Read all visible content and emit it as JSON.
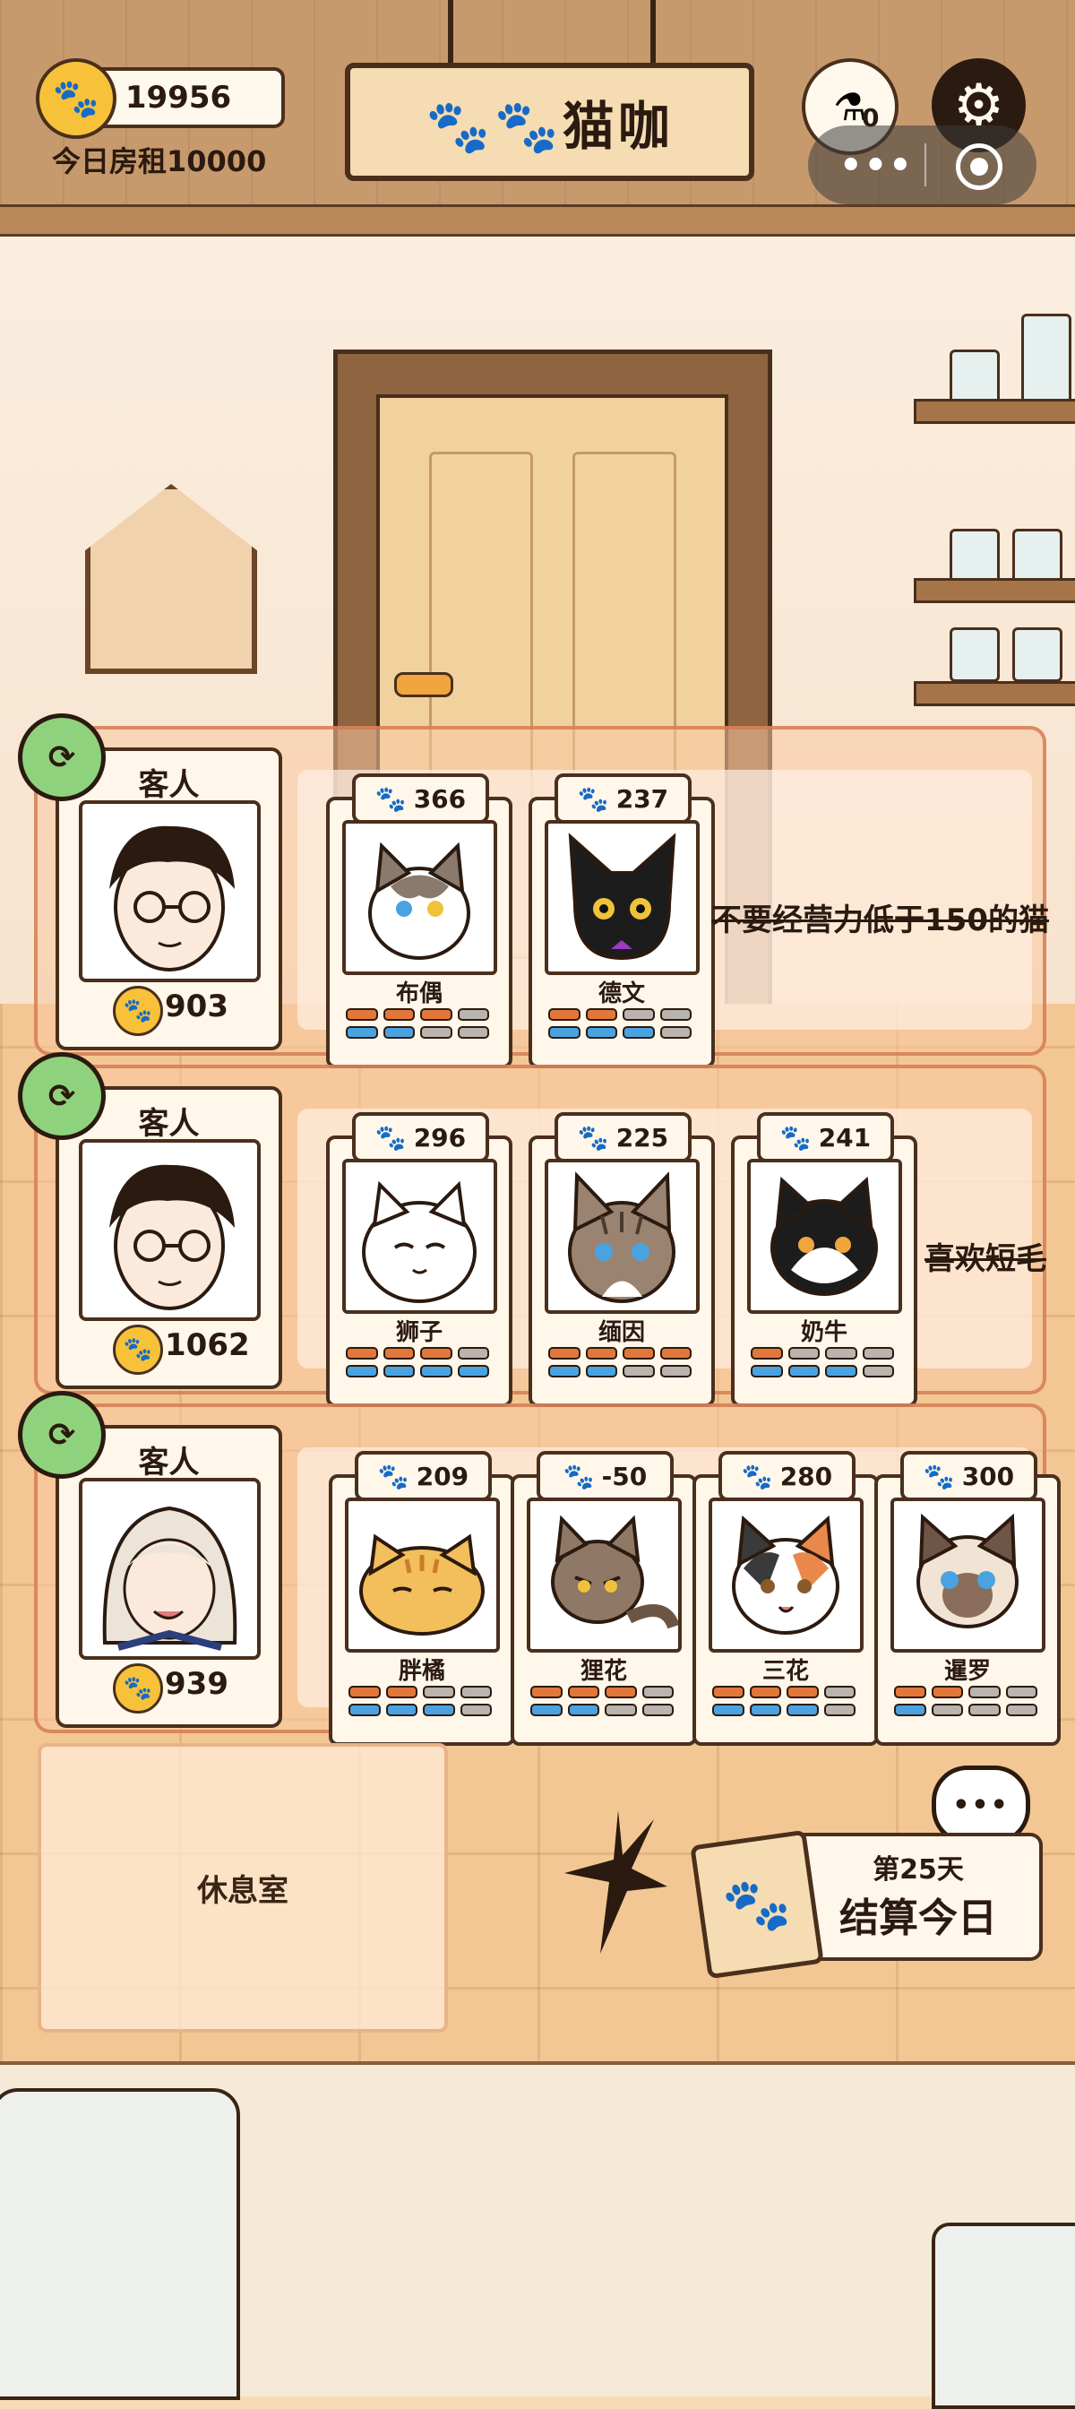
{
  "hud": {
    "coins": "19956",
    "rent": "今日房租10000",
    "title": "🐾🐾猫咖",
    "potion_count": "0",
    "coin_icon": "paw-icon",
    "settings_icon": "gear-icon"
  },
  "rows": [
    {
      "guest_label": "客人",
      "guest_value": "903",
      "hint": "不要经营力低于150的猫",
      "cats": [
        {
          "score": "366",
          "name": "布偶"
        },
        {
          "score": "237",
          "name": "德文"
        }
      ]
    },
    {
      "guest_label": "客人",
      "guest_value": "1062",
      "hint": "喜欢短毛",
      "cats": [
        {
          "score": "296",
          "name": "狮子"
        },
        {
          "score": "225",
          "name": "缅因"
        },
        {
          "score": "241",
          "name": "奶牛"
        }
      ]
    },
    {
      "guest_label": "客人",
      "guest_value": "939",
      "hint": "",
      "cats": [
        {
          "score": "209",
          "name": "胖橘"
        },
        {
          "score": "-50",
          "name": "狸花"
        },
        {
          "score": "280",
          "name": "三花"
        },
        {
          "score": "300",
          "name": "暹罗"
        }
      ]
    }
  ],
  "restroom_label": "休息室",
  "settle": {
    "day": "第25天",
    "label": "结算今日"
  },
  "colors": {
    "accent_orange": "#e2773a",
    "accent_blue": "#4aa3e0",
    "refresh_green": "#8fd27d",
    "coin_gold": "#f7c23a"
  }
}
